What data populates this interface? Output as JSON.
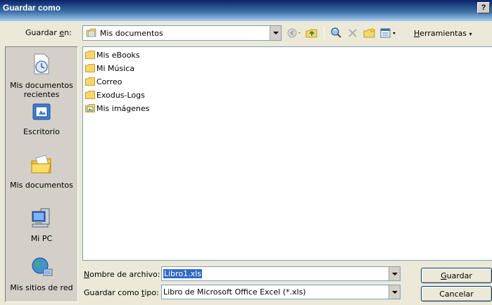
{
  "window": {
    "title": "Guardar como",
    "help_label": "?"
  },
  "lookin": {
    "label_prefix": "Guardar ",
    "label_accel": "e",
    "label_suffix": "n:",
    "value": "Mis documentos",
    "icon": "folder-documents-icon"
  },
  "toolbar": {
    "items": [
      "back-icon",
      "up-folder-icon",
      "search-web-icon",
      "delete-icon",
      "new-folder-icon",
      "views-icon"
    ],
    "tools_accel": "H",
    "tools_rest": "erramientas"
  },
  "places": [
    {
      "label": "Mis documentos recientes",
      "icon": "recent-documents-icon"
    },
    {
      "label": "Escritorio",
      "icon": "desktop-icon"
    },
    {
      "label": "Mis documentos",
      "icon": "my-documents-icon"
    },
    {
      "label": "Mi PC",
      "icon": "my-computer-icon"
    },
    {
      "label": "Mis sitios de red",
      "icon": "network-places-icon"
    }
  ],
  "files": [
    {
      "name": "Mis eBooks",
      "icon": "folder-icon"
    },
    {
      "name": "Mi Música",
      "icon": "folder-icon"
    },
    {
      "name": "Correo",
      "icon": "folder-icon"
    },
    {
      "name": "Exodus-Logs",
      "icon": "folder-icon"
    },
    {
      "name": "Mis imágenes",
      "icon": "pictures-folder-icon"
    }
  ],
  "filename": {
    "label_accel": "N",
    "label_rest": "ombre de archivo:",
    "value": "Libro1.xls"
  },
  "filetype": {
    "label_prefix": "Guardar como ",
    "label_accel": "t",
    "label_suffix": "ipo:",
    "value": "Libro de Microsoft Office Excel (*.xls)"
  },
  "buttons": {
    "save_accel": "G",
    "save_rest": "uardar",
    "cancel": "Cancelar"
  },
  "colors": {
    "titlebar": "#0a246a",
    "selection": "#316ac5",
    "field_border": "#7f9db9"
  }
}
